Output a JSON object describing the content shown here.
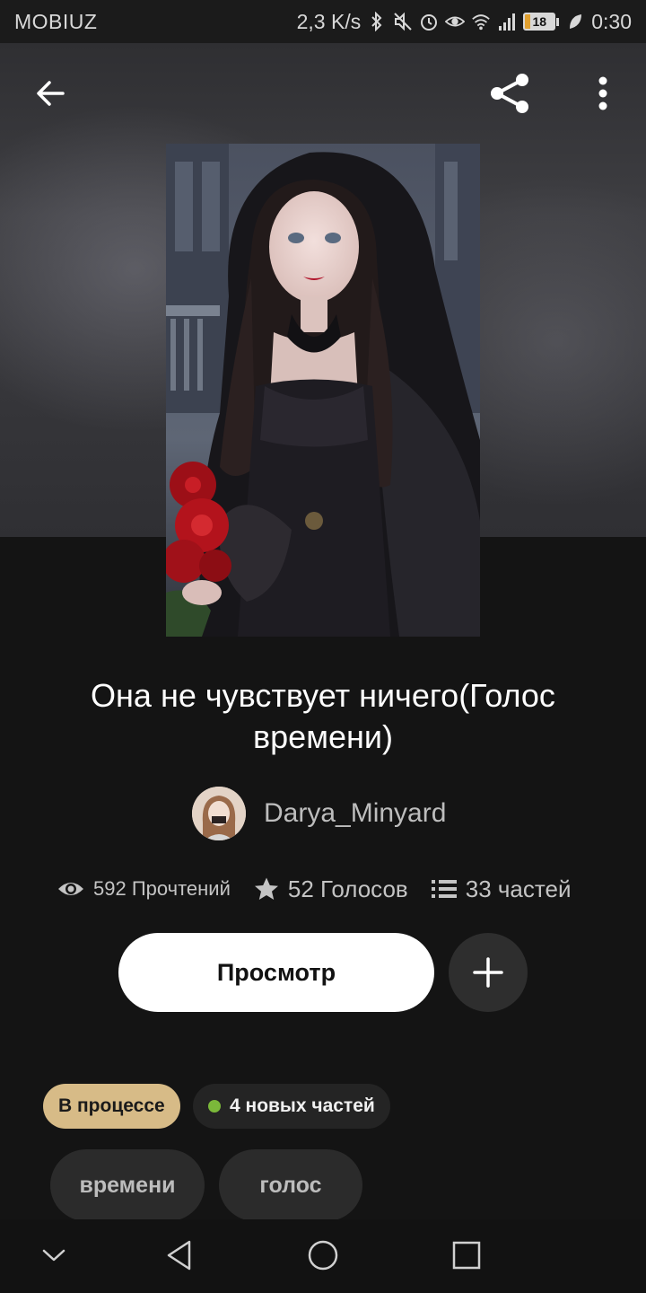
{
  "status_bar": {
    "carrier": "MOBIUZ",
    "speed": "2,3 K/s",
    "battery": "18",
    "time": "0:30",
    "icons": [
      "bluetooth-icon",
      "mute-icon",
      "alarm-icon",
      "eye-comfort-icon",
      "wifi-icon",
      "signal-icon",
      "battery-icon",
      "leaf-icon"
    ]
  },
  "toolbar": {
    "back_icon": "arrow-left-icon",
    "share_icon": "share-icon",
    "more_icon": "more-vertical-icon"
  },
  "story": {
    "cover_alt": "cover-image",
    "title": "Она не чувствует ничего(Голос времени)",
    "author": "Darya_Minyard",
    "stats": {
      "reads": "592 Прочтений",
      "votes": "52 Голосов",
      "parts": "33 частей"
    }
  },
  "actions": {
    "read_label": "Просмотр",
    "add_icon": "plus-icon"
  },
  "badges": {
    "status": "В процессе",
    "new_parts": "4 новых частей"
  },
  "tags": [
    "времени",
    "голос"
  ],
  "colors": {
    "background": "#141414",
    "status_badge": "#d7bb87",
    "new_dot": "#7bb83a",
    "tag_bg": "#2b2b2b"
  },
  "nav_bar": {
    "icons": [
      "chevron-down-icon",
      "back-triangle-icon",
      "home-circle-icon",
      "recents-square-icon"
    ]
  }
}
